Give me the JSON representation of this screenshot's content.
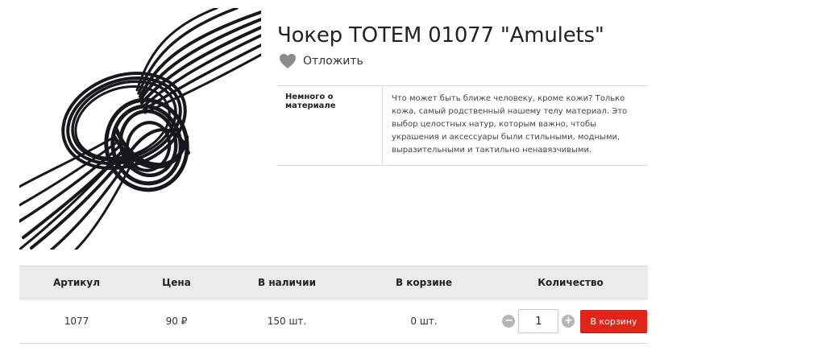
{
  "product": {
    "title": "Чокер TOTEM 01077 \"Amulets\"",
    "image_alt": "black leather cord choker with knot",
    "wishlist_label": "Отложить",
    "wishlist_icon": "heart-icon"
  },
  "properties": [
    {
      "name": "Немного о материале",
      "value": "Что может быть ближе человеку, кроме кожи? Только кожа, самый родственный нашему телу материал. Это выбор целостных натур, которым важно, чтобы украшения и аксессуары были стильными, модными, выразительными и тактильно ненавязчивыми."
    }
  ],
  "offer_table": {
    "headers": [
      "Артикул",
      "Цена",
      "В наличии",
      "В корзине",
      "Количество"
    ],
    "row": {
      "article": "1077",
      "price": "90 ₽",
      "in_stock": "150 шт.",
      "in_cart": "0 шт.",
      "quantity": "1"
    },
    "minus_label": "−",
    "plus_label": "+",
    "cart_button_label": "В корзину"
  },
  "colors": {
    "accent": "#e1251b",
    "header_bg": "#ebebeb",
    "icon_gray": "#b5b5b5"
  }
}
